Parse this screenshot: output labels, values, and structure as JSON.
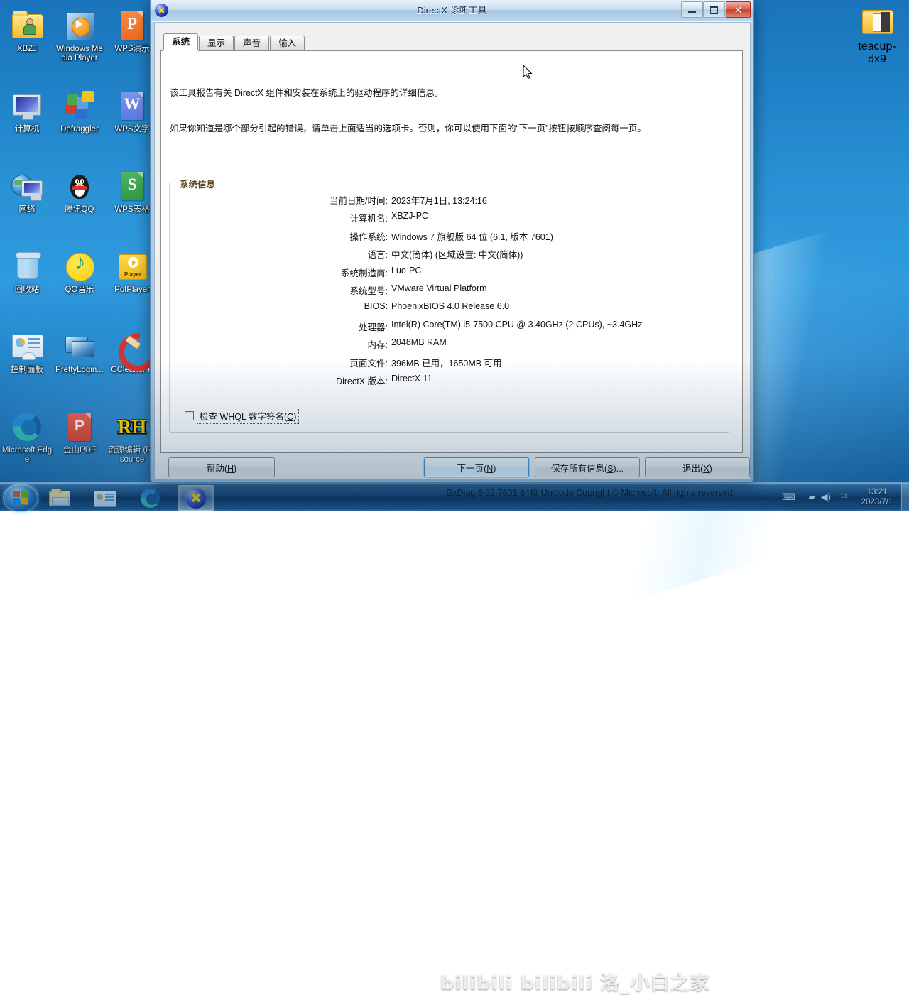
{
  "desktop": {
    "icons": [
      {
        "label": "XBZJ",
        "icon": "user-folder-icon"
      },
      {
        "label": "Windows Media Player",
        "icon": "windows-media-player-icon"
      },
      {
        "label": "WPS演示",
        "icon": "wps-presentation-icon"
      },
      {
        "label": "计算机",
        "icon": "computer-icon"
      },
      {
        "label": "Defraggler",
        "icon": "defraggler-icon"
      },
      {
        "label": "WPS文字",
        "icon": "wps-writer-icon"
      },
      {
        "label": "网络",
        "icon": "network-icon"
      },
      {
        "label": "腾讯QQ",
        "icon": "tencent-qq-icon"
      },
      {
        "label": "WPS表格",
        "icon": "wps-spreadsheet-icon"
      },
      {
        "label": "回收站",
        "icon": "recycle-bin-icon"
      },
      {
        "label": "QQ音乐",
        "icon": "qq-music-icon"
      },
      {
        "label": "PotPlayer",
        "icon": "potplayer-icon"
      },
      {
        "label": "控制面板",
        "icon": "control-panel-icon"
      },
      {
        "label": "PrettyLogin...",
        "icon": "prettylogin-icon"
      },
      {
        "label": "CCleaner P",
        "icon": "ccleaner-icon"
      },
      {
        "label": "Microsoft Edge",
        "icon": "microsoft-edge-icon"
      },
      {
        "label": "金山PDF",
        "icon": "kingsoft-pdf-icon"
      },
      {
        "label": "资源编辑 (Resource",
        "icon": "resource-hacker-icon"
      }
    ],
    "right_icon": {
      "label": "teacup-dx9",
      "icon": "folder-icon"
    }
  },
  "taskbar": {
    "start_label": "开始",
    "buttons": [
      {
        "name": "windows-explorer",
        "icon": "folder-icon"
      },
      {
        "name": "control-panel",
        "icon": "control-panel-icon"
      },
      {
        "name": "microsoft-edge",
        "icon": "edge-icon"
      },
      {
        "name": "dxdiag",
        "icon": "dxdiag-icon",
        "active": true
      }
    ],
    "tray": [
      "keyboard-icon",
      "network-icon",
      "volume-icon",
      "action-center-icon"
    ],
    "clock_time": "13:21",
    "clock_date": "2023/7/1",
    "watermark": "bilibili bilibili 洛_小白之家"
  },
  "window": {
    "title": "DirectX 诊断工具",
    "icon": "dxdiag-icon",
    "minimize_label": "最小化",
    "maximize_label": "最大化",
    "close_label": "关闭",
    "tabs": [
      {
        "label": "系统",
        "selected": true
      },
      {
        "label": "显示",
        "selected": false
      },
      {
        "label": "声音",
        "selected": false
      },
      {
        "label": "输入",
        "selected": false
      }
    ],
    "description_1": "该工具报告有关 DirectX 组件和安装在系统上的驱动程序的详细信息。",
    "description_2": "如果你知道是哪个部分引起的错误，请单击上面适当的选项卡。否则，你可以使用下面的“下一页”按钮按顺序查阅每一页。",
    "groupbox_label": "系统信息",
    "system_info": [
      {
        "key": "当前日期/时间:",
        "value": "2023年7月1日, 13:24:16"
      },
      {
        "key": "计算机名:",
        "value": "XBZJ-PC"
      },
      {
        "key": "操作系统:",
        "value": "Windows 7 旗舰版 64 位 (6.1, 版本 7601)"
      },
      {
        "key": "语言:",
        "value": "中文(简体) (区域设置: 中文(简体))"
      },
      {
        "key": "系统制造商:",
        "value": "Luo-PC"
      },
      {
        "key": "系统型号:",
        "value": "VMware Virtual Platform"
      },
      {
        "key": "BIOS:",
        "value": "PhoenixBIOS 4.0 Release 6.0"
      },
      {
        "key": "处理器:",
        "value": "Intel(R) Core(TM) i5-7500 CPU @ 3.40GHz (2 CPUs), ~3.4GHz"
      },
      {
        "key": "内存:",
        "value": "2048MB RAM"
      },
      {
        "key": "页面文件:",
        "value": "396MB 已用，1650MB 可用"
      },
      {
        "key": "DirectX 版本:",
        "value": "DirectX 11"
      }
    ],
    "whql_label_pre": "检查 WHQL 数字签名(",
    "whql_accel": "C",
    "whql_label_post": ")",
    "whql_checked": false,
    "copyright": "DxDiag 6.02.7601 64位 Unicode Copright © Microsoft. All rights reserved.",
    "footer_buttons": [
      {
        "name": "help-button",
        "pre": "帮助(",
        "accel": "H",
        "post": ")",
        "focus": false
      },
      {
        "name": "next-page-button",
        "pre": "下一页(",
        "accel": "N",
        "post": ")",
        "focus": true
      },
      {
        "name": "save-all-info-button",
        "pre": "保存所有信息(",
        "accel": "S",
        "post": ")...",
        "focus": false
      },
      {
        "name": "exit-button",
        "pre": "退出(",
        "accel": "X",
        "post": ")",
        "focus": false
      }
    ]
  },
  "colors": {
    "accent": "#3c99d4",
    "close_button": "#c13f29",
    "groupbox_label": "#5c4a1e",
    "desktop_blue": "#2a93d6"
  }
}
